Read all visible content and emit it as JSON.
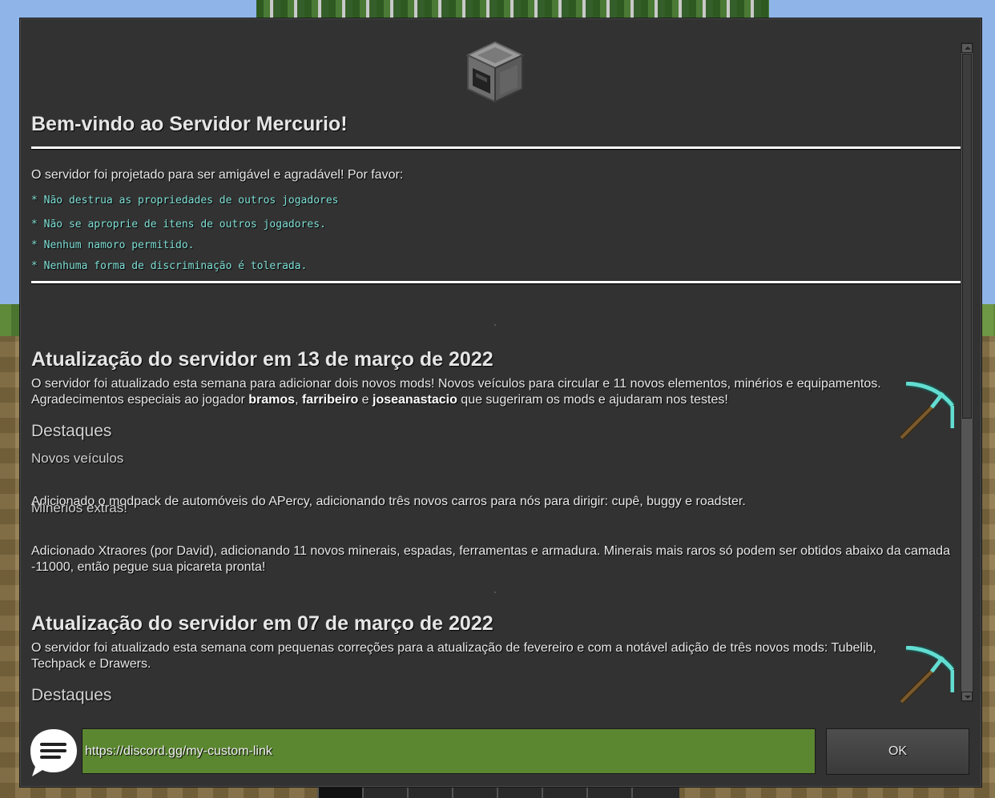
{
  "colors": {
    "panel_bg": "#323232",
    "rule_color": "#7fe0d6",
    "url_field_bg": "#5b8731",
    "button_bg": "#444444"
  },
  "icons": {
    "header_image": "furnace-icon",
    "news_image": "diamond-pickaxe-icon",
    "chat": "chat-bubble-icon"
  },
  "welcome": {
    "title": "Bem-vindo ao Servidor Mercurio!",
    "intro": "O servidor foi projetado para ser amigável e agradável! Por favor:",
    "rules": [
      "* Não destrua as propriedades de outros jogadores",
      "* Não se aproprie de itens de outros jogadores.",
      "* Nenhum namoro permitido.",
      "* Nenhuma forma de discriminação é tolerada."
    ]
  },
  "updates": [
    {
      "title": "Atualização do servidor em 13 de março de 2022",
      "para_start": "O servidor foi atualizado esta semana para adicionar dois novos mods! Novos veículos para circular e 11 novos elementos, minérios e equipamentos. Agradecimentos especiais ao jogador ",
      "player1": "bramos",
      "sep1": ", ",
      "player2": "farribeiro",
      "sep2": " e ",
      "player3": "joseanastacio",
      "para_end": " que sugeriram os mods e ajudaram nos testes!",
      "highlights_heading": "Destaques",
      "sub1_title": "Novos veículos",
      "sub1_text": "Adicionado o modpack de automóveis do APercy, adicionando três novos carros para nós para dirigir: cupê, buggy e roadster.",
      "sub2_title": "Minérios extras!",
      "sub2_text": "Adicionado Xtraores (por David), adicionando 11 novos minerais, espadas, ferramentas e armadura. Minerais mais raros só podem ser obtidos abaixo da camada -11000, então pegue sua picareta pronta!"
    },
    {
      "title": "Atualização do servidor em 07 de março de 2022",
      "para": "O servidor foi atualizado esta semana com pequenas correções para a atualização de fevereiro e com a notável adição de três novos mods: Tubelib, Techpack e Drawers.",
      "highlights_heading": "Destaques"
    }
  ],
  "bottom": {
    "url_value": "https://discord.gg/my-custom-link",
    "ok_label": "OK"
  }
}
